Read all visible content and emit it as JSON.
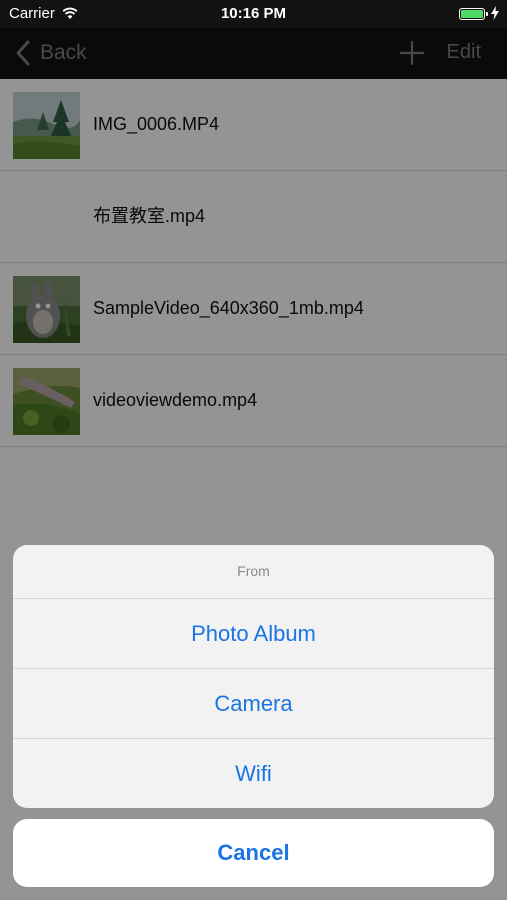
{
  "status_bar": {
    "carrier": "Carrier",
    "time": "10:16 PM",
    "battery_level": 1.0,
    "battery_color": "#4cd964",
    "icons": [
      "wifi-icon",
      "battery-icon",
      "charging-bolt-icon"
    ]
  },
  "nav_bar": {
    "back_label": "Back",
    "add_icon": "plus-icon",
    "edit_label": "Edit"
  },
  "files": [
    {
      "name": "IMG_0006.MP4",
      "thumbnail": "forest-landscape"
    },
    {
      "name": "布置教室.mp4",
      "thumbnail": ""
    },
    {
      "name": "SampleVideo_640x360_1mb.mp4",
      "thumbnail": "bunny-character"
    },
    {
      "name": "videoviewdemo.mp4",
      "thumbnail": "mossy-garden"
    }
  ],
  "action_sheet": {
    "title": "From",
    "actions": [
      "Photo Album",
      "Camera",
      "Wifi"
    ],
    "cancel_label": "Cancel",
    "accent_color": "#1a74e4"
  }
}
